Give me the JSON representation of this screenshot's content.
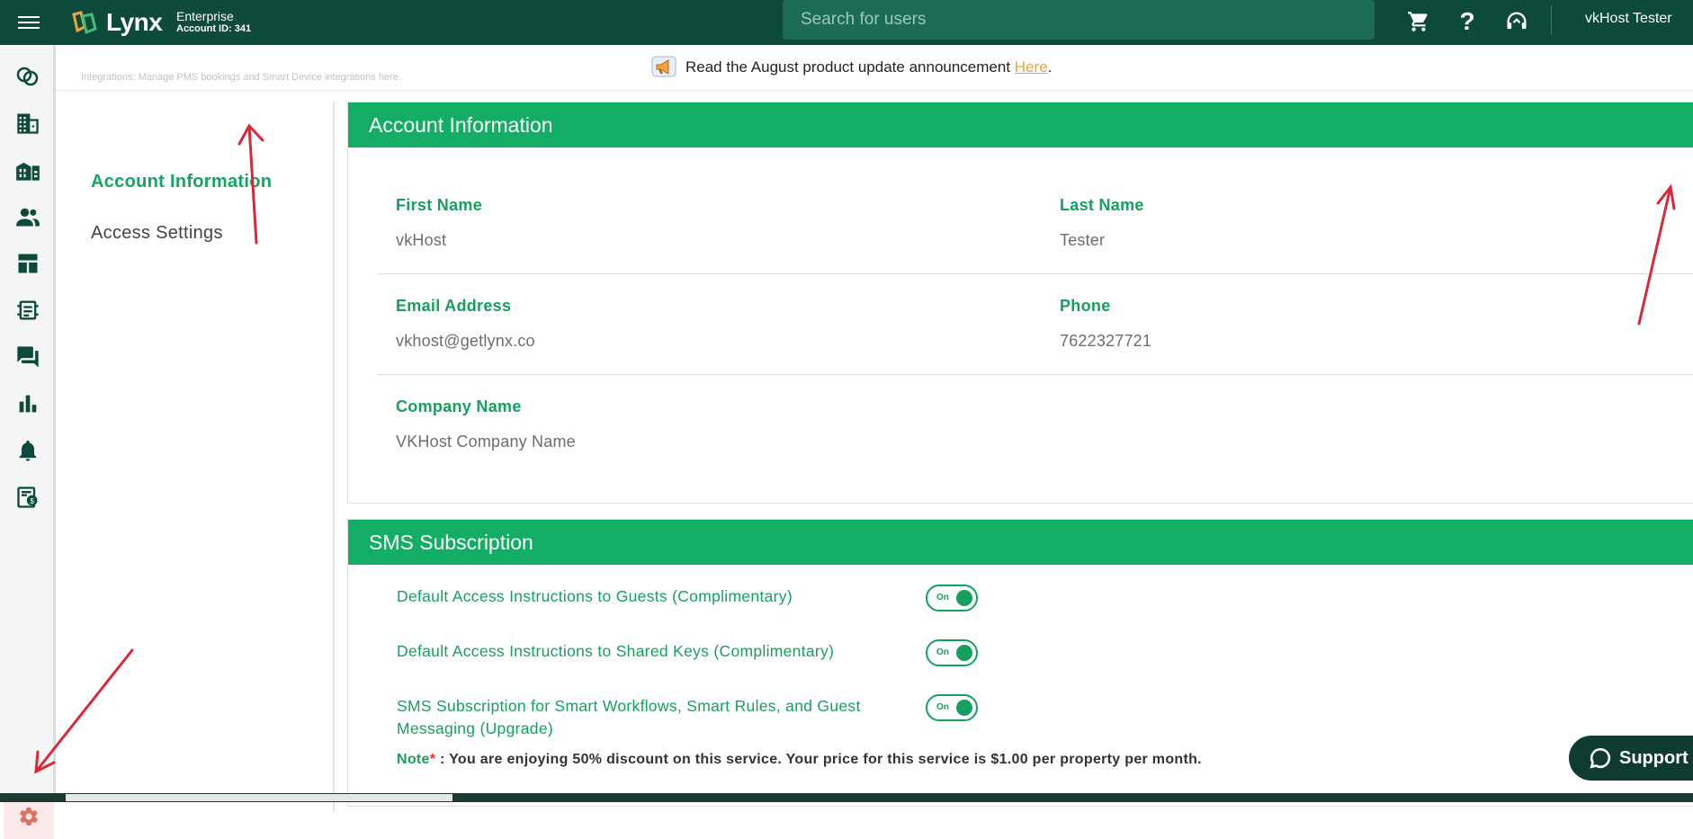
{
  "header": {
    "brand": "Lynx",
    "plan": "Enterprise",
    "account_id": "Account ID: 341",
    "search_placeholder": "Search for users",
    "user_name": "vkHost Tester"
  },
  "banner": {
    "breadcrumb": "Integrations: Manage PMS bookings and Smart Device integrations here.",
    "announcement_text": "Read the August product update announcement",
    "announcement_link": "Here",
    "announcement_end": "."
  },
  "left_menu": {
    "items": [
      {
        "label": "Account Information"
      },
      {
        "label": "Access Settings"
      }
    ]
  },
  "account_card": {
    "title": "Account Information",
    "fields": {
      "first_name_label": "First Name",
      "first_name": "vkHost",
      "last_name_label": "Last Name",
      "last_name": "Tester",
      "email_label": "Email Address",
      "email": "vkhost@getlynx.co",
      "phone_label": "Phone",
      "phone": "7622327721",
      "company_label": "Company Name",
      "company": "VKHost Company Name"
    }
  },
  "sms_card": {
    "title": "SMS Subscription",
    "rows": [
      {
        "label": "Default Access Instructions to Guests (Complimentary)",
        "toggle": "On"
      },
      {
        "label": "Default Access Instructions to Shared Keys (Complimentary)",
        "toggle": "On"
      },
      {
        "label": "SMS Subscription for Smart Workflows, Smart Rules, and Guest Messaging (Upgrade)",
        "toggle": "On"
      }
    ],
    "note_label": "Note",
    "note_star": "*",
    "note_text": " : You are enjoying 50% discount on this service. Your price for this service is $1.00 per property per month."
  },
  "support_label": "Support",
  "colors": {
    "topbar": "#0d4a3c",
    "accent_green": "#14ad65",
    "link_orange": "#f0a23c",
    "annotation_red": "#d9283a"
  },
  "icons": [
    "menu-icon",
    "cart-icon",
    "help-icon",
    "headset-icon",
    "integrations-icon",
    "building-icon",
    "properties-icon",
    "users-icon",
    "layout-icon",
    "devices-icon",
    "messages-icon",
    "analytics-icon",
    "bell-icon",
    "billing-icon",
    "settings-gear-icon",
    "megaphone-icon",
    "edit-icon",
    "chat-icon"
  ]
}
